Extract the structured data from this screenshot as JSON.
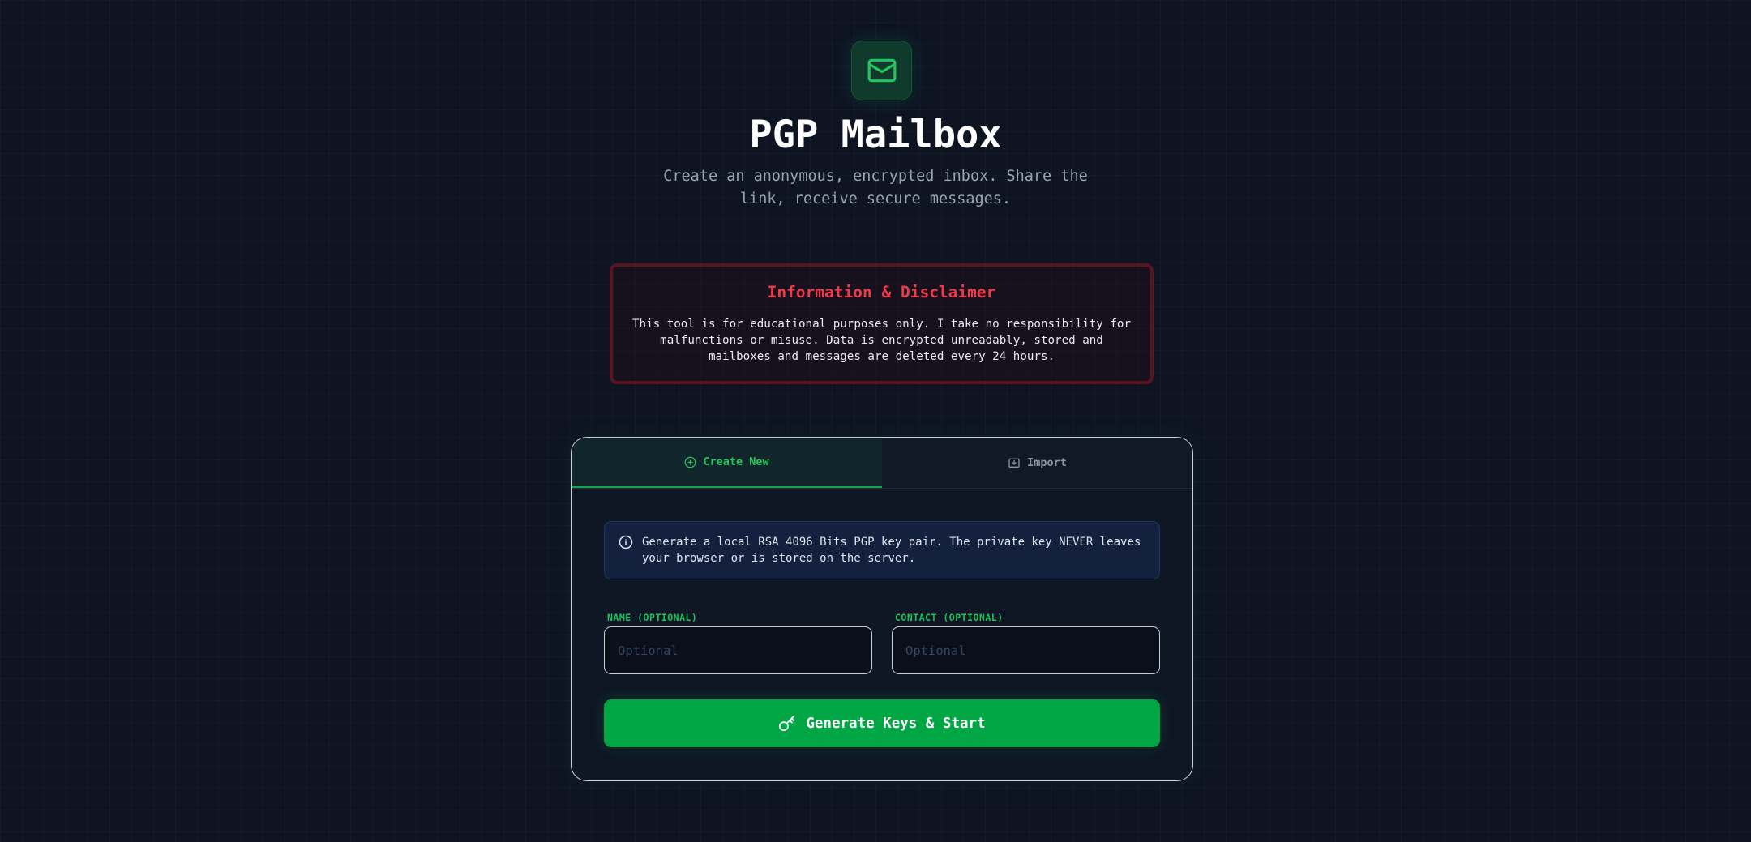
{
  "app": {
    "icon": "mail-icon",
    "title": "PGP Mailbox",
    "subtitle": "Create an anonymous, encrypted inbox. Share the link, receive secure messages."
  },
  "disclaimer": {
    "title": "Information & Disclaimer",
    "text": "This tool is for educational purposes only. I take no responsibility for malfunctions or misuse. Data is encrypted unreadably, stored and mailboxes and messages are deleted every 24 hours."
  },
  "tabs": [
    {
      "label": "Create New",
      "icon": "plus-circle-icon",
      "active": true
    },
    {
      "label": "Import",
      "icon": "import-icon",
      "active": false
    }
  ],
  "create": {
    "info_icon": "info-icon",
    "info_text": "Generate a local RSA 4096 Bits PGP key pair. The private key NEVER leaves your browser or is stored on the server.",
    "name_label": "NAME (OPTIONAL)",
    "name_placeholder": "Optional",
    "name_value": "",
    "contact_label": "CONTACT (OPTIONAL)",
    "contact_placeholder": "Optional",
    "contact_value": "",
    "button_icon": "key-icon",
    "button_label": "Generate Keys & Start"
  },
  "colors": {
    "background": "#0e1422",
    "accent": "#00a644",
    "accent_text": "#22c55e",
    "danger": "#ef3a4a",
    "info_bg": "#13213f"
  }
}
